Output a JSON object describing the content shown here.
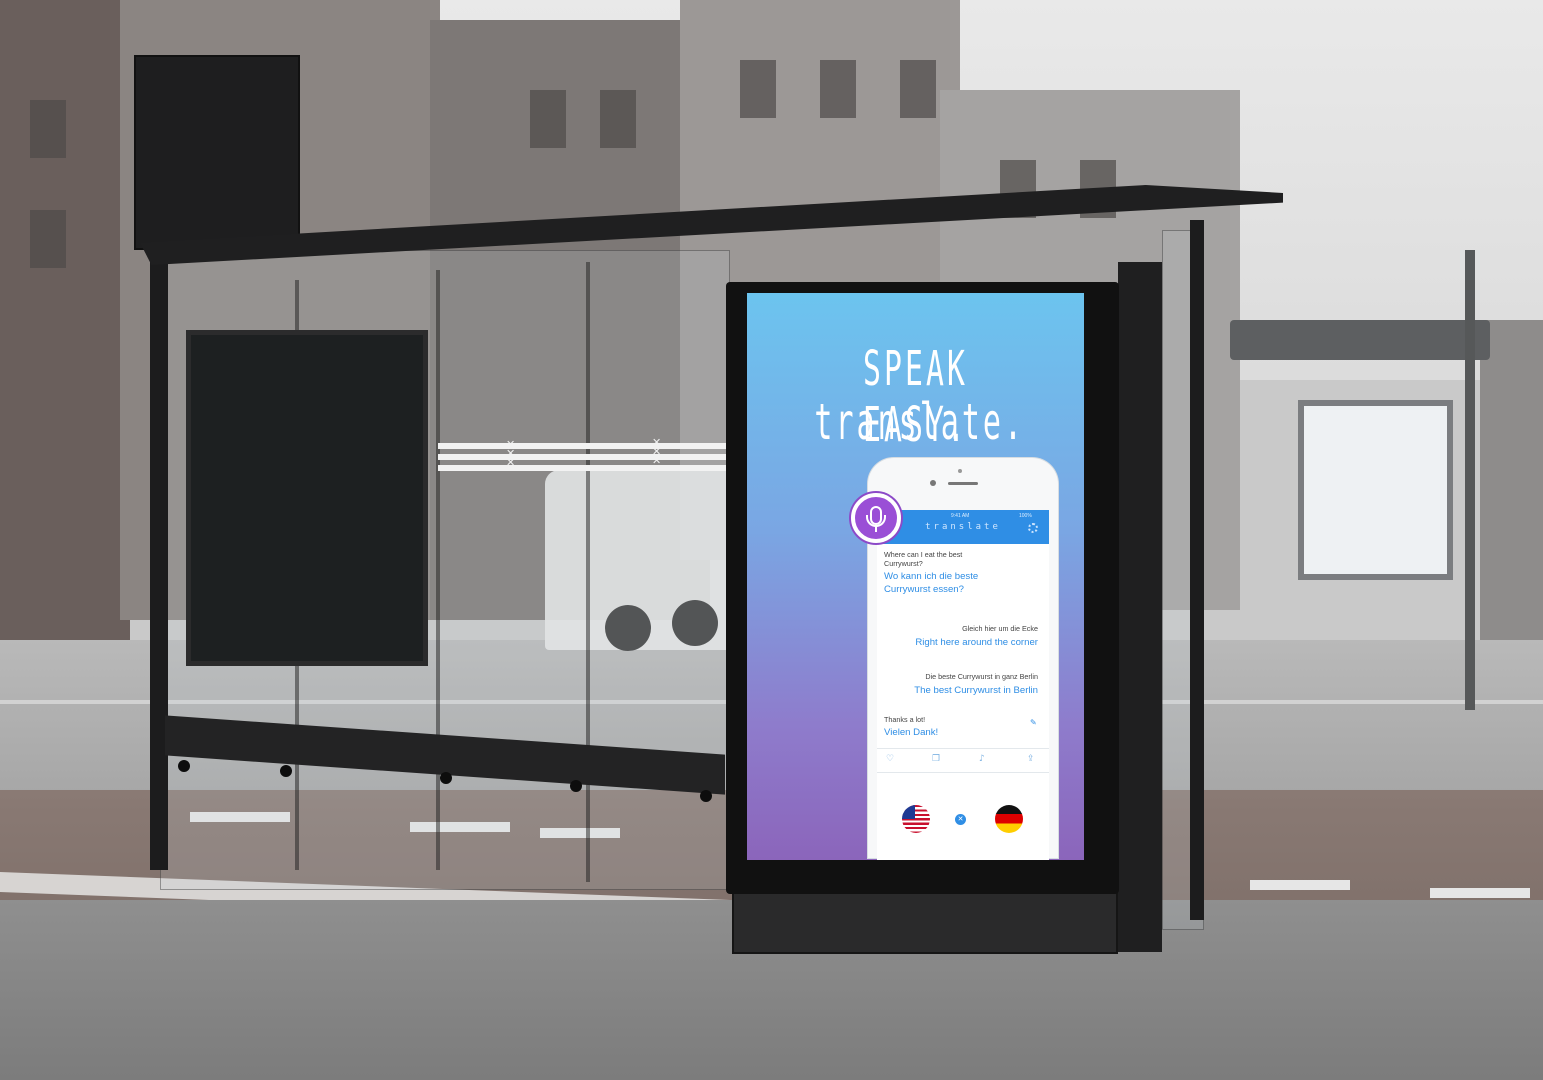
{
  "advertisement": {
    "headline_line1": "SPEAK EASY.",
    "headline_line2": "translate."
  },
  "phone_app": {
    "status_time": "9:41 AM",
    "battery": "100%",
    "app_title": "translate",
    "conversation": [
      {
        "original": "Where can I eat the best Currywurst?",
        "translation": "Wo kann ich die beste Currywurst essen?",
        "align": "left"
      },
      {
        "original": "Gleich hier um die Ecke",
        "translation": "Right here around the corner",
        "align": "right"
      },
      {
        "original": "Die beste Currywurst in ganz Berlin",
        "translation": "The best Currywurst in Berlin",
        "align": "right"
      },
      {
        "original": "Thanks a lot!",
        "translation": "Vielen Dank!",
        "align": "left"
      }
    ],
    "toolbar_icons": [
      "heart-icon",
      "copy-icon",
      "speaker-icon",
      "share-icon"
    ],
    "source_language_flag": "us-flag-icon",
    "target_language_flag": "germany-flag-icon",
    "colors": {
      "accent": "#2f8ee5",
      "mic_button": "#9a4fd6",
      "gradient_top": "#6cc4ef",
      "gradient_bottom": "#8b65bb"
    }
  }
}
